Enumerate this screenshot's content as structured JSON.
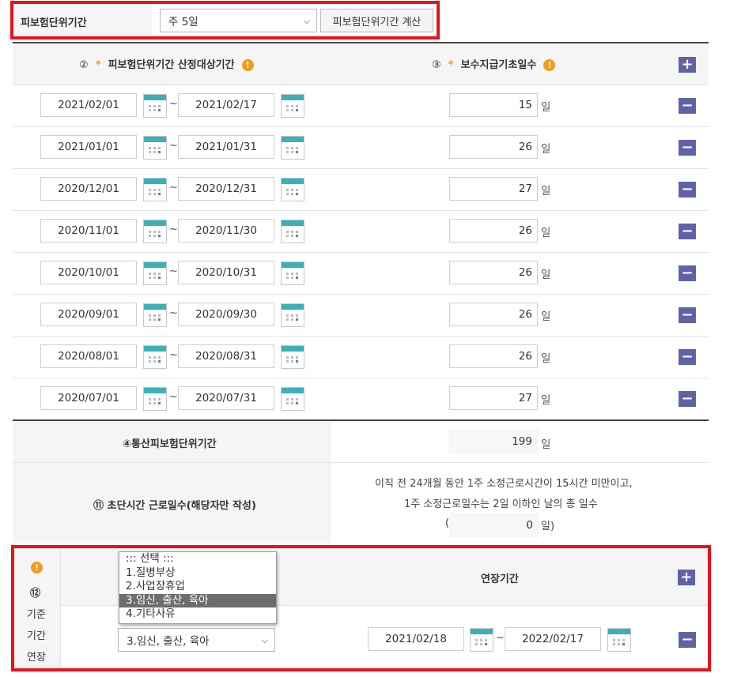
{
  "unit_period": {
    "label": "피보험단위기간",
    "select_value": "주 5일",
    "calc_button": "피보험단위기간 계산"
  },
  "header": {
    "col2_num": "②",
    "col2_label": "피보험단위기간 산정대상기간",
    "col3_num": "③",
    "col3_label": "보수지급기초일수",
    "star": "*",
    "warn": "!",
    "plus": "+"
  },
  "rows": [
    {
      "start": "2021/02/01",
      "end": "2021/02/17",
      "days": "15"
    },
    {
      "start": "2021/01/01",
      "end": "2021/01/31",
      "days": "26"
    },
    {
      "start": "2020/12/01",
      "end": "2020/12/31",
      "days": "27"
    },
    {
      "start": "2020/11/01",
      "end": "2020/11/30",
      "days": "26"
    },
    {
      "start": "2020/10/01",
      "end": "2020/10/31",
      "days": "26"
    },
    {
      "start": "2020/09/01",
      "end": "2020/09/30",
      "days": "26"
    },
    {
      "start": "2020/08/01",
      "end": "2020/08/31",
      "days": "26"
    },
    {
      "start": "2020/07/01",
      "end": "2020/07/31",
      "days": "27"
    }
  ],
  "common": {
    "tilde": "~",
    "day_unit": "일",
    "minus": "−"
  },
  "total": {
    "label": "④통산피보험단위기간",
    "value": "199",
    "unit": "일"
  },
  "short_time": {
    "label": "⑪ 초단시간 근로일수(해당자만 작성)",
    "desc_line1": "이직 전 24개월 동안 1주 소정근로시간이 15시간 미만이고,",
    "desc_line2": "1주 소정근로일수는 2일 이하인 날의 총 일수",
    "paren_open": "(",
    "value": "0",
    "unit_close": "일)"
  },
  "extension": {
    "warn": "!",
    "num": "⑫",
    "label_line1": "기준",
    "label_line2": "기간",
    "label_line3": "연장",
    "header_label": "연장기간",
    "plus": "+",
    "dropdown_options": [
      "::: 선택 :::",
      "1.질병부상",
      "2.사업장휴업",
      "3.임신, 출산, 육아",
      "4.기타사유"
    ],
    "select_value": "3.임신, 출산, 육아",
    "start": "2021/02/18",
    "end": "2022/02/17",
    "tilde": "~",
    "minus": "−"
  },
  "colors": {
    "highlight_border": "#e5131d",
    "button_bg": "#5f63a6",
    "warn_icon": "#f49b1d",
    "calendar_header": "#3bb0b9",
    "dropdown_selected": "#6d6d6d"
  }
}
